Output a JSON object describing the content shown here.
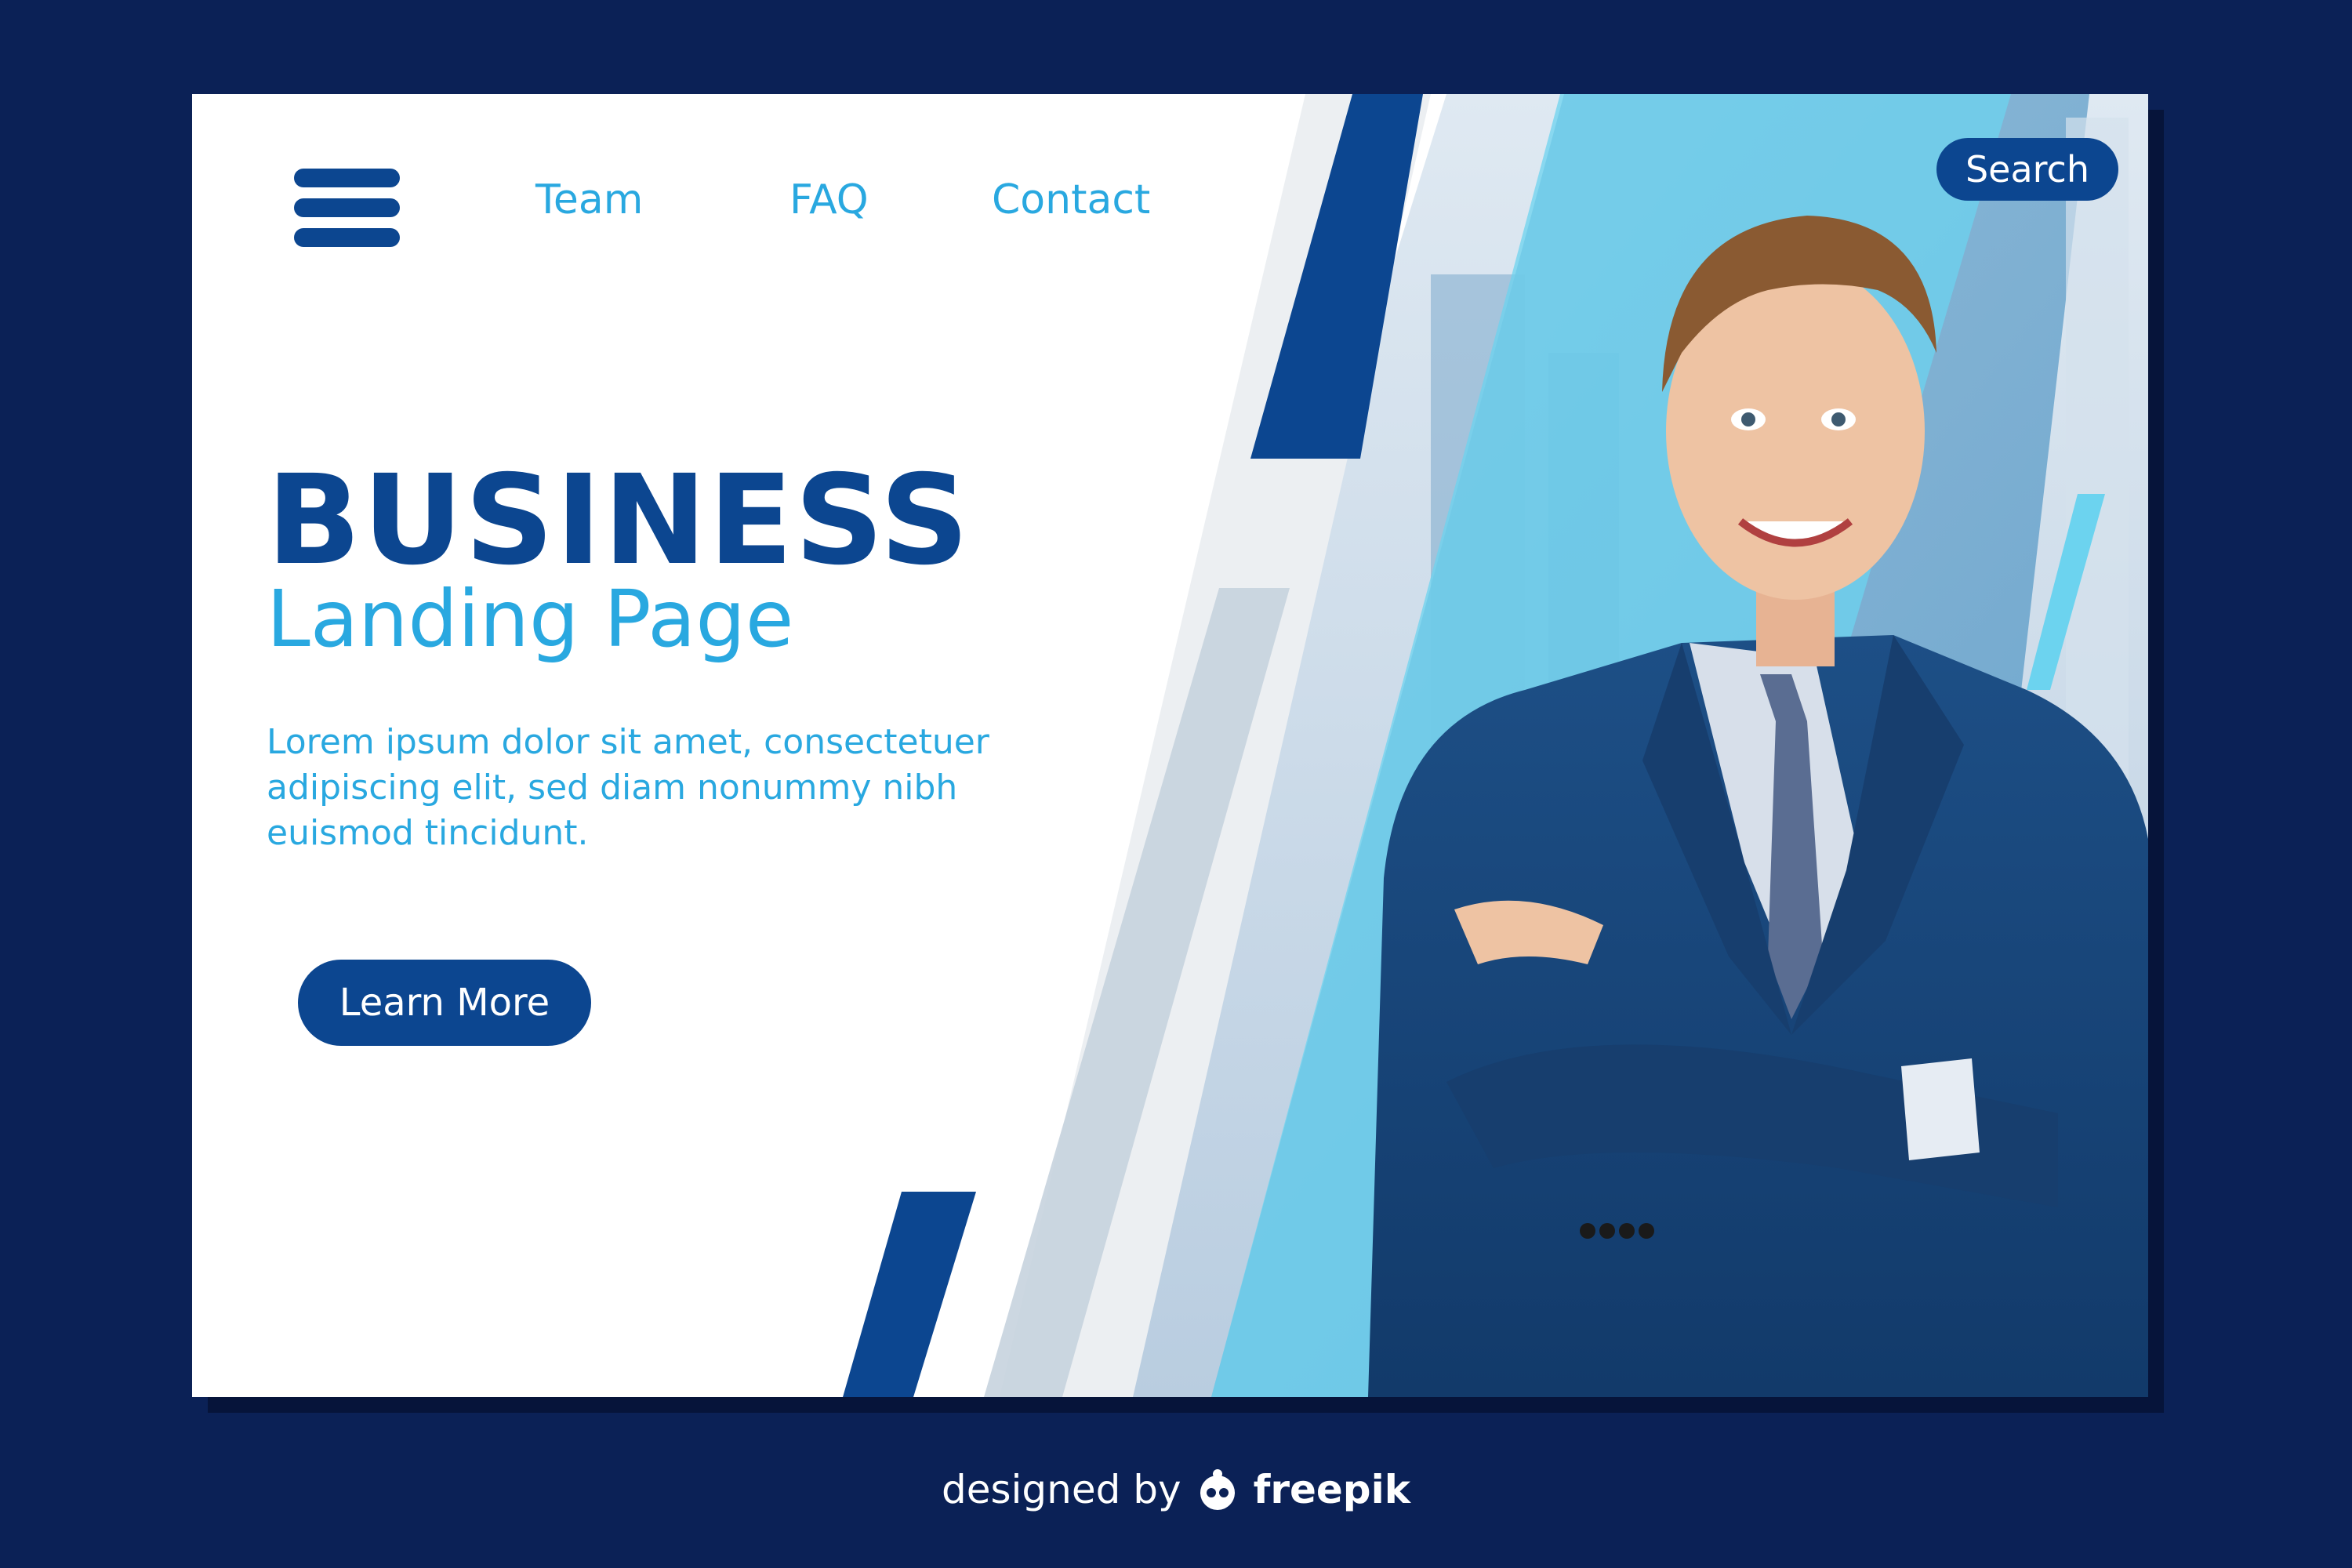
{
  "nav": {
    "links": [
      "Team",
      "FAQ",
      "Contact"
    ],
    "search_label": "Search"
  },
  "hero": {
    "title": "BUSINESS",
    "subtitle": "Landing Page",
    "body": "Lorem ipsum dolor sit amet, consectetuer adipiscing elit, sed diam nonummy nibh euismod tincidunt.",
    "button_label": "Learn More"
  },
  "footer": {
    "credit_prefix": "designed by",
    "credit_brand": "freepik"
  },
  "icons": [
    "menu-icon",
    "freepik-logo-icon"
  ],
  "colors": {
    "background": "#0b2156",
    "primary": "#0c4690",
    "accent": "#29a8e0",
    "card": "#ffffff"
  }
}
